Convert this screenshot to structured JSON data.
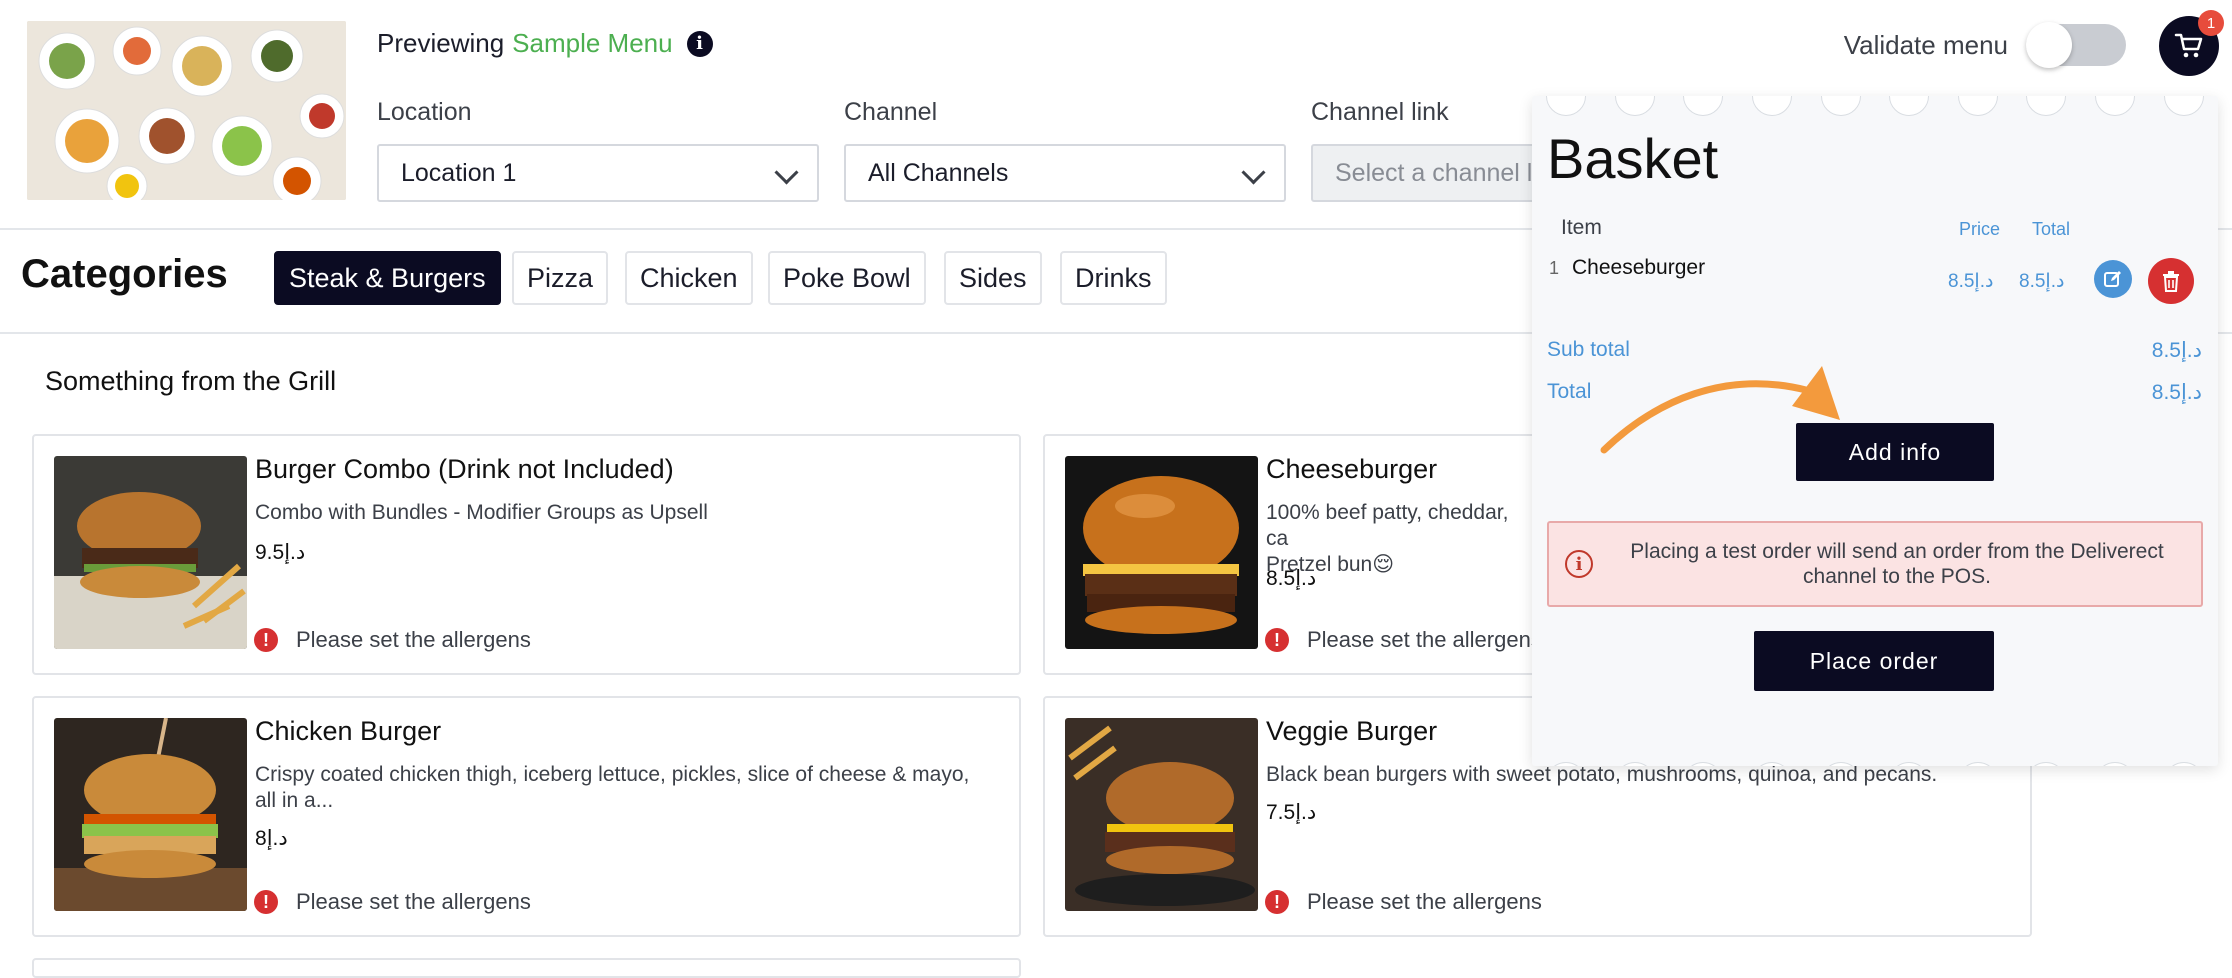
{
  "header": {
    "previewing_label": "Previewing",
    "menu_name": "Sample Menu",
    "validate_label": "Validate menu",
    "cart_count": "1",
    "location": {
      "label": "Location",
      "value": "Location 1"
    },
    "channel": {
      "label": "Channel",
      "value": "All Channels"
    },
    "channel_link": {
      "label": "Channel link",
      "placeholder": "Select a channel l"
    }
  },
  "categories": {
    "title": "Categories",
    "items": [
      "Steak & Burgers",
      "Pizza",
      "Chicken",
      "Poke Bowl",
      "Sides",
      "Drinks"
    ],
    "active": "Steak & Burgers"
  },
  "section": {
    "title": "Something from the Grill"
  },
  "products": [
    {
      "name": "Burger Combo (Drink not Included)",
      "desc": "Combo with Bundles - Modifier Groups as Upsell",
      "price": "9.5د.إ",
      "allergen": "Please set the allergens"
    },
    {
      "name": "Cheeseburger",
      "desc": "100% beef patty, cheddar, ca",
      "desc2": "Pretzel bun😌",
      "price": "8.5د.إ",
      "allergen": "Please set the allergens"
    },
    {
      "name": "Chicken Burger",
      "desc": "Crispy coated chicken thigh, iceberg lettuce, pickles, slice of cheese & mayo, all in a...",
      "price": "8د.إ",
      "allergen": "Please set the allergens"
    },
    {
      "name": "Veggie Burger",
      "desc": "Black bean burgers with sweet potato, mushrooms, quinoa, and pecans.",
      "price": "7.5د.إ",
      "allergen": "Please set the allergens"
    }
  ],
  "basket": {
    "title": "Basket",
    "col_item": "Item",
    "col_price": "Price",
    "col_total": "Total",
    "items": [
      {
        "qty": "1",
        "name": "Cheeseburger",
        "price": "8.5د.إ",
        "total": "8.5د.إ"
      }
    ],
    "subtotal_label": "Sub total",
    "subtotal_value": "8.5د.إ",
    "total_label": "Total",
    "total_value": "8.5د.إ",
    "add_info_label": "Add info",
    "alert_text": "Placing a test order will send an order from the Deliverect channel to the POS.",
    "place_order_label": "Place order"
  },
  "colors": {
    "brand_dark": "#0b0b22",
    "accent_green": "#4caf50",
    "link_blue": "#4b94d6",
    "danger": "#d63031",
    "arrow_orange": "#f39a3d"
  }
}
